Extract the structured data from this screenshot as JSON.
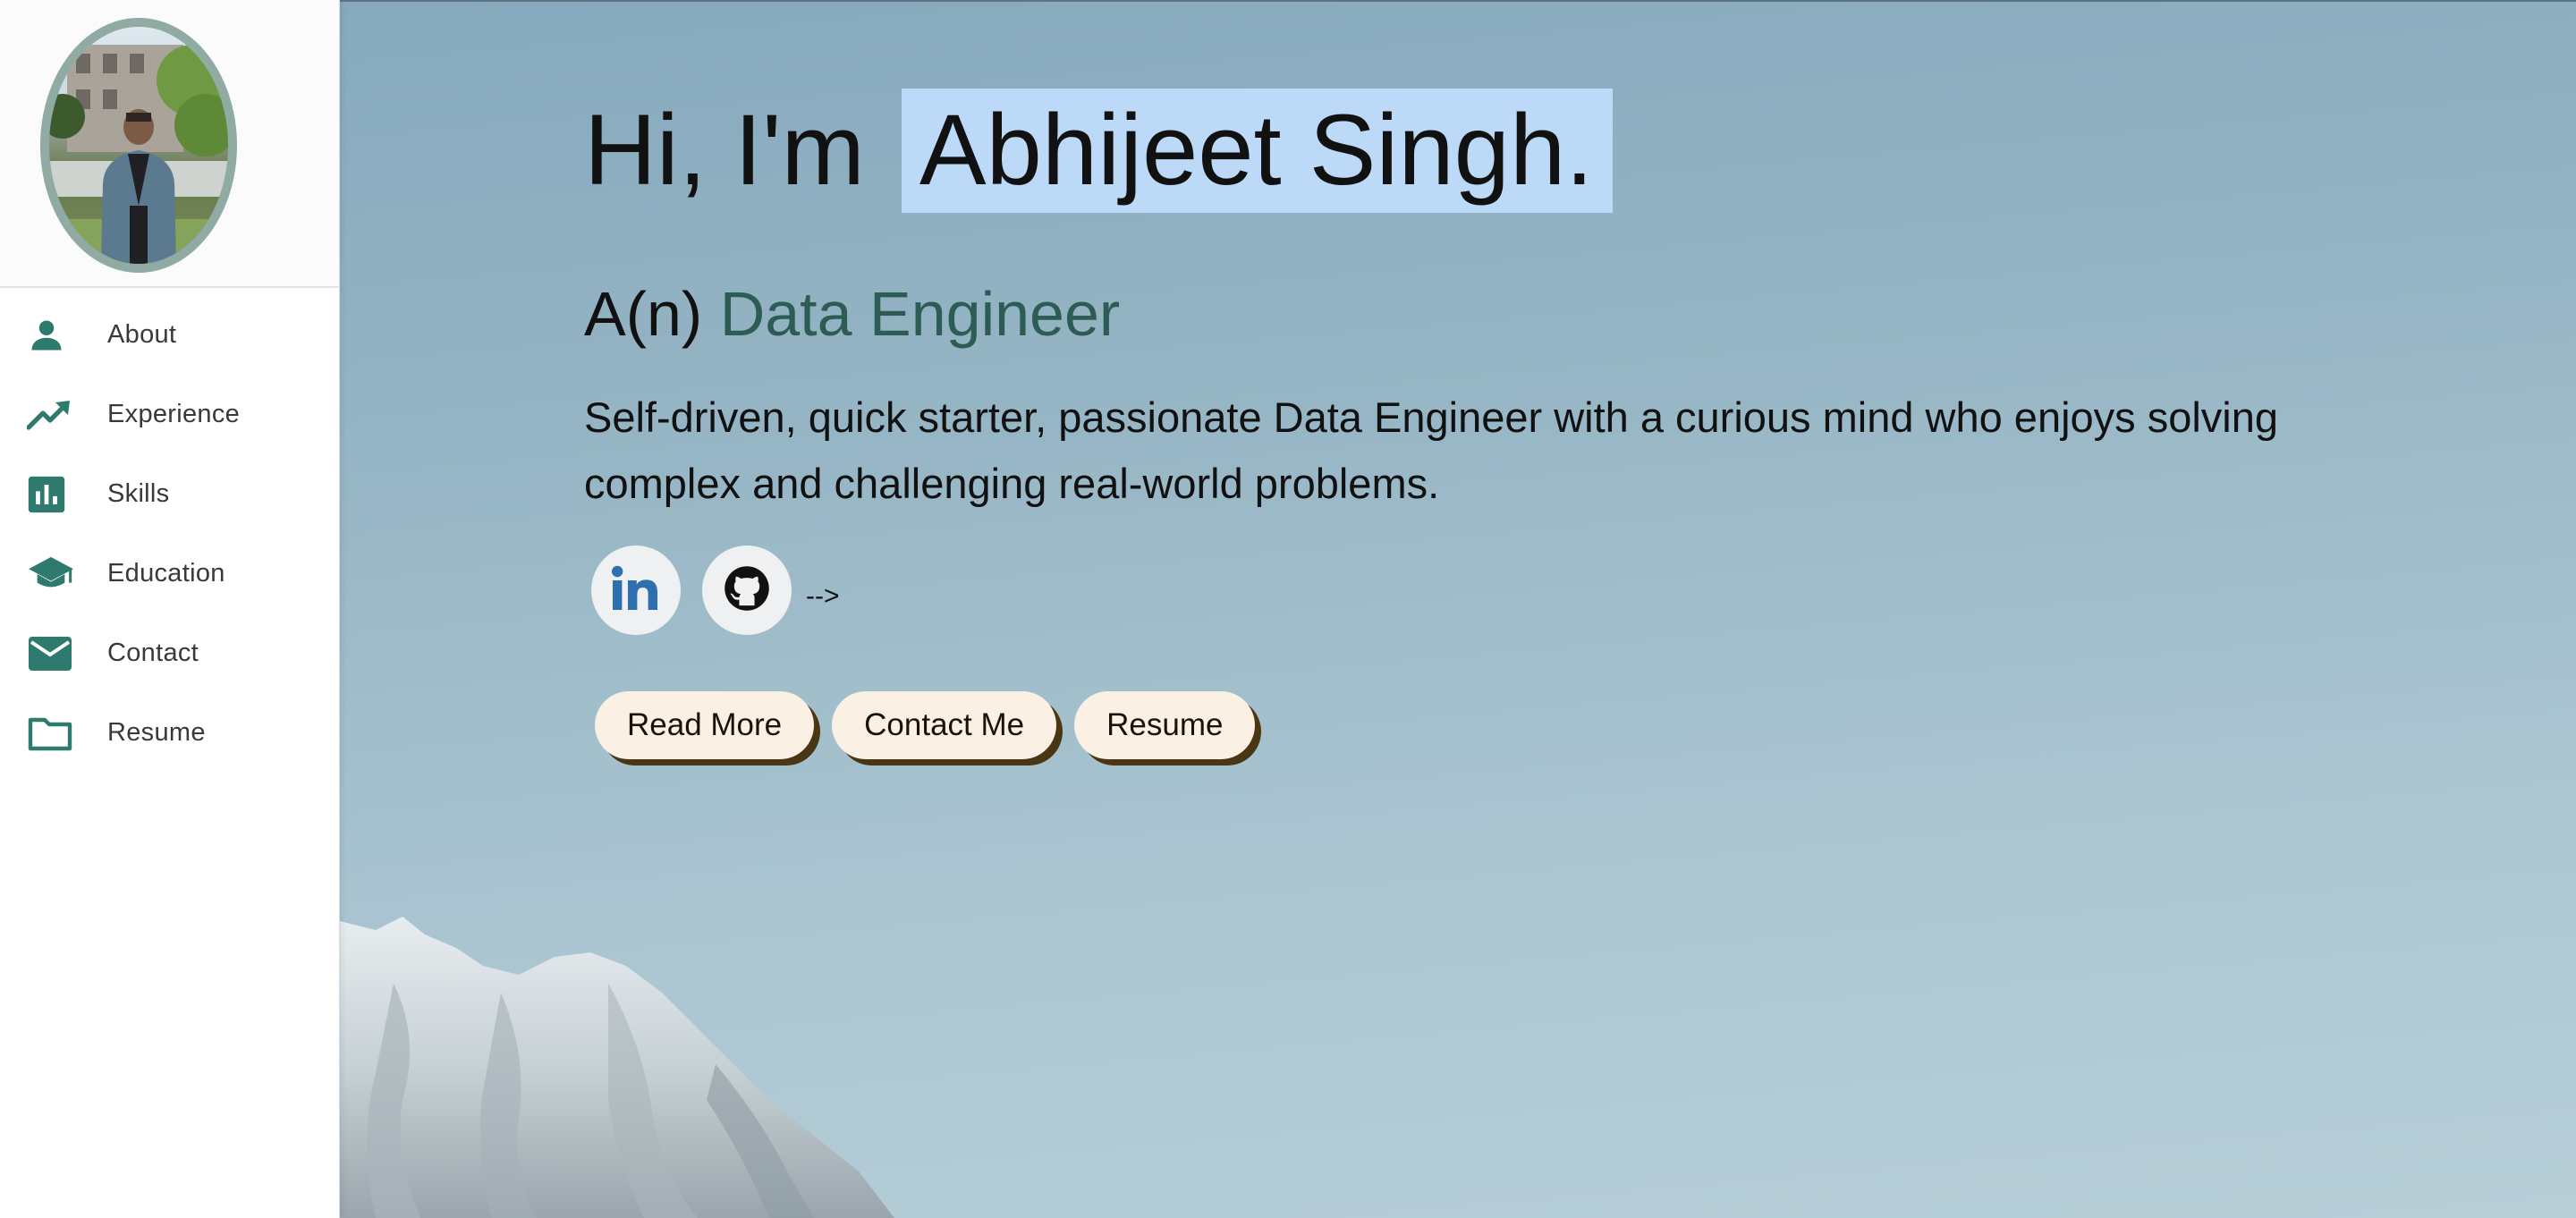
{
  "sidebar": {
    "profile_photo": "profile-photo",
    "items": [
      {
        "label": "About",
        "icon": "person-icon"
      },
      {
        "label": "Experience",
        "icon": "trending-up-icon"
      },
      {
        "label": "Skills",
        "icon": "bar-chart-icon"
      },
      {
        "label": "Education",
        "icon": "graduation-cap-icon"
      },
      {
        "label": "Contact",
        "icon": "envelope-icon"
      },
      {
        "label": "Resume",
        "icon": "folder-icon"
      }
    ],
    "icon_color": "#2f7a6e"
  },
  "hero": {
    "greeting": "Hi, I'm",
    "name": "Abhijeet Singh.",
    "role_prefix": "A(n)",
    "role": "Data Engineer",
    "bio": "Self-driven, quick starter, passionate Data Engineer with a curious mind who enjoys solving complex and challenging real-world problems.",
    "arrow_text": "-->",
    "name_highlight_color": "#bcdaf8",
    "role_color": "#2d5c54"
  },
  "social": {
    "linkedin_icon": "linkedin-icon",
    "github_icon": "github-icon",
    "linkedin_color": "#2e6fad"
  },
  "actions": {
    "read_more": "Read More",
    "contact_me": "Contact Me",
    "resume": "Resume",
    "button_bg": "#fbf0e4",
    "button_shadow": "#4a3514"
  }
}
